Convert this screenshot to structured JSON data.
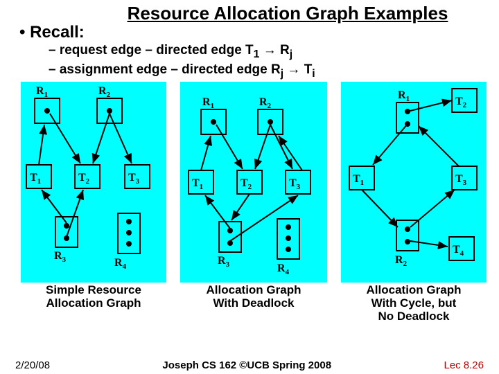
{
  "title": "Resource Allocation Graph Examples",
  "recall_label": "Recall:",
  "sub1": "– request edge – directed edge T",
  "sub1_sub1": "1",
  "sub1_arrow": " → ",
  "sub1_R": "R",
  "sub1_sub2": "j",
  "sub2": "– assignment edge – directed edge R",
  "sub2_sub1": "j",
  "sub2_arrow": " → ",
  "sub2_T": "T",
  "sub2_sub2": "i",
  "labels": {
    "R1": "R",
    "R1s": "1",
    "R2": "R",
    "R2s": "2",
    "R3": "R",
    "R3s": "3",
    "R4": "R",
    "R4s": "4",
    "T1": "T",
    "T1s": "1",
    "T2": "T",
    "T2s": "2",
    "T3": "T",
    "T3s": "3",
    "T4": "T",
    "T4s": "4"
  },
  "caption1": "Simple Resource\nAllocation Graph",
  "caption2": "Allocation Graph\nWith Deadlock",
  "caption3": "Allocation Graph\nWith Cycle, but\nNo Deadlock",
  "footer_left": "2/20/08",
  "footer_center": "Joseph CS 162 ©UCB Spring 2008",
  "footer_right": "Lec 8.26"
}
